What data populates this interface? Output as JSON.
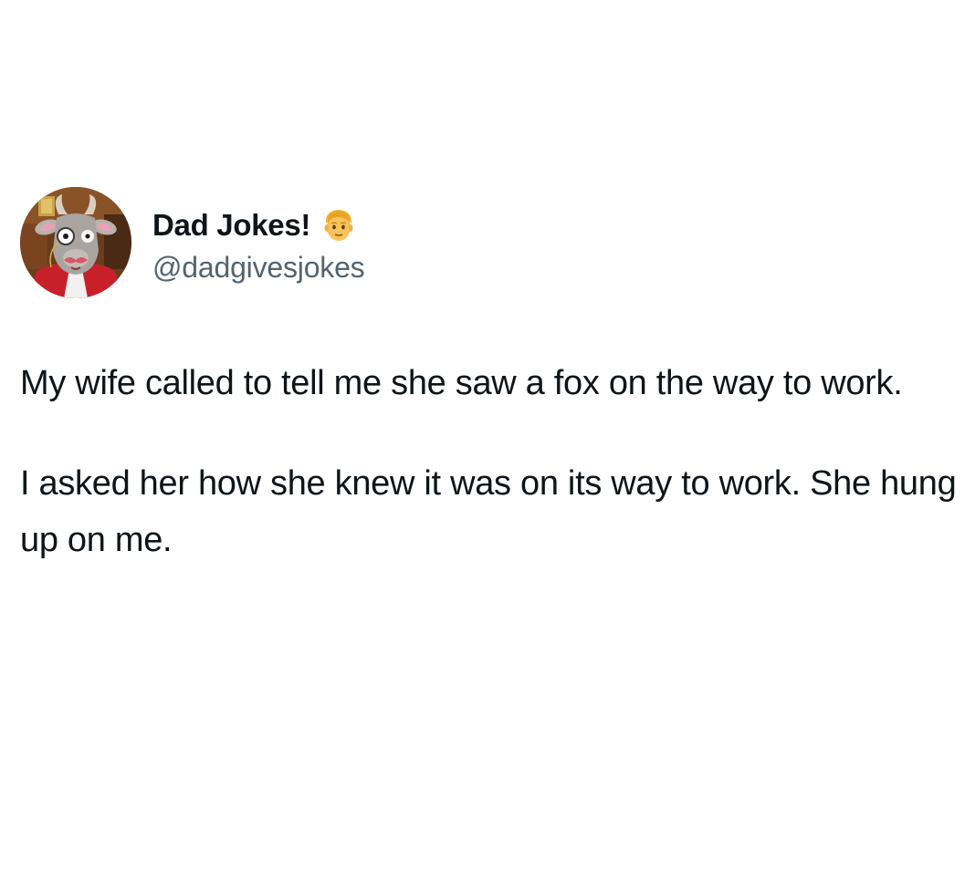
{
  "post": {
    "author": {
      "display_name": "Dad Jokes!",
      "handle": "@dadgivesjokes",
      "avatar_icon": "cartoon-goat-with-monocle-avatar",
      "badge_icon": "man-blond-hair-emoji"
    },
    "paragraphs": [
      "My wife called to tell me she saw a fox on the way to work.",
      "I asked her how she knew it was on its way to work. She hung up on me."
    ]
  },
  "colors": {
    "background": "#ffffff",
    "text": "#0f1419",
    "secondary_text": "#536471"
  }
}
